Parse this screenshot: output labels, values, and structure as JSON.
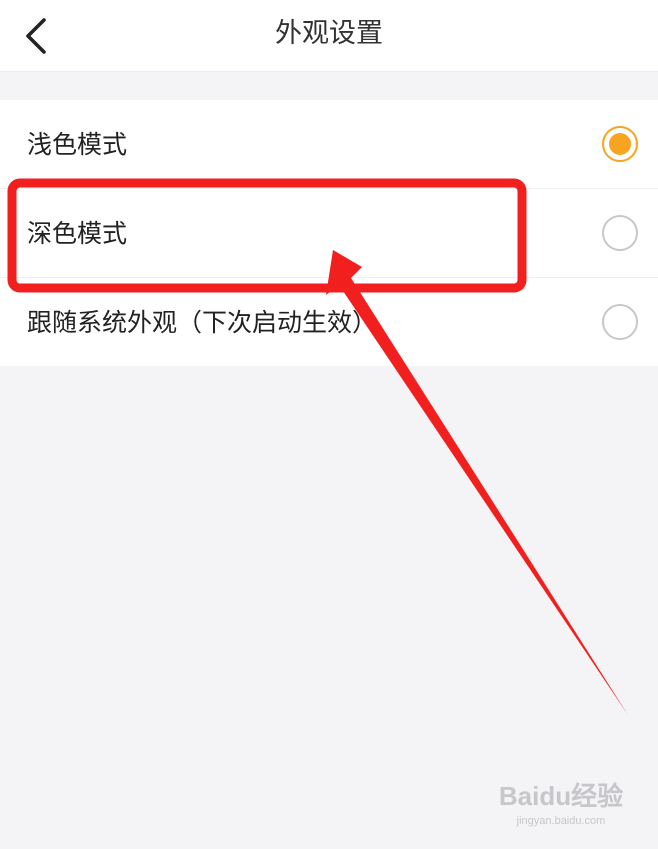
{
  "header": {
    "title": "外观设置",
    "back_icon": "chevron-left-icon"
  },
  "options": [
    {
      "label": "浅色模式",
      "selected": true
    },
    {
      "label": "深色模式",
      "selected": false
    },
    {
      "label": "跟随系统外观（下次启动生效）",
      "selected": false
    }
  ],
  "annotation": {
    "highlight_color": "#f21f1f",
    "highlighted_option": "深色模式"
  },
  "colors": {
    "accent": "#f7a520",
    "background": "#f4f4f6"
  },
  "watermark": {
    "logo": "Baidu经验",
    "url": "jingyan.baidu.com"
  }
}
